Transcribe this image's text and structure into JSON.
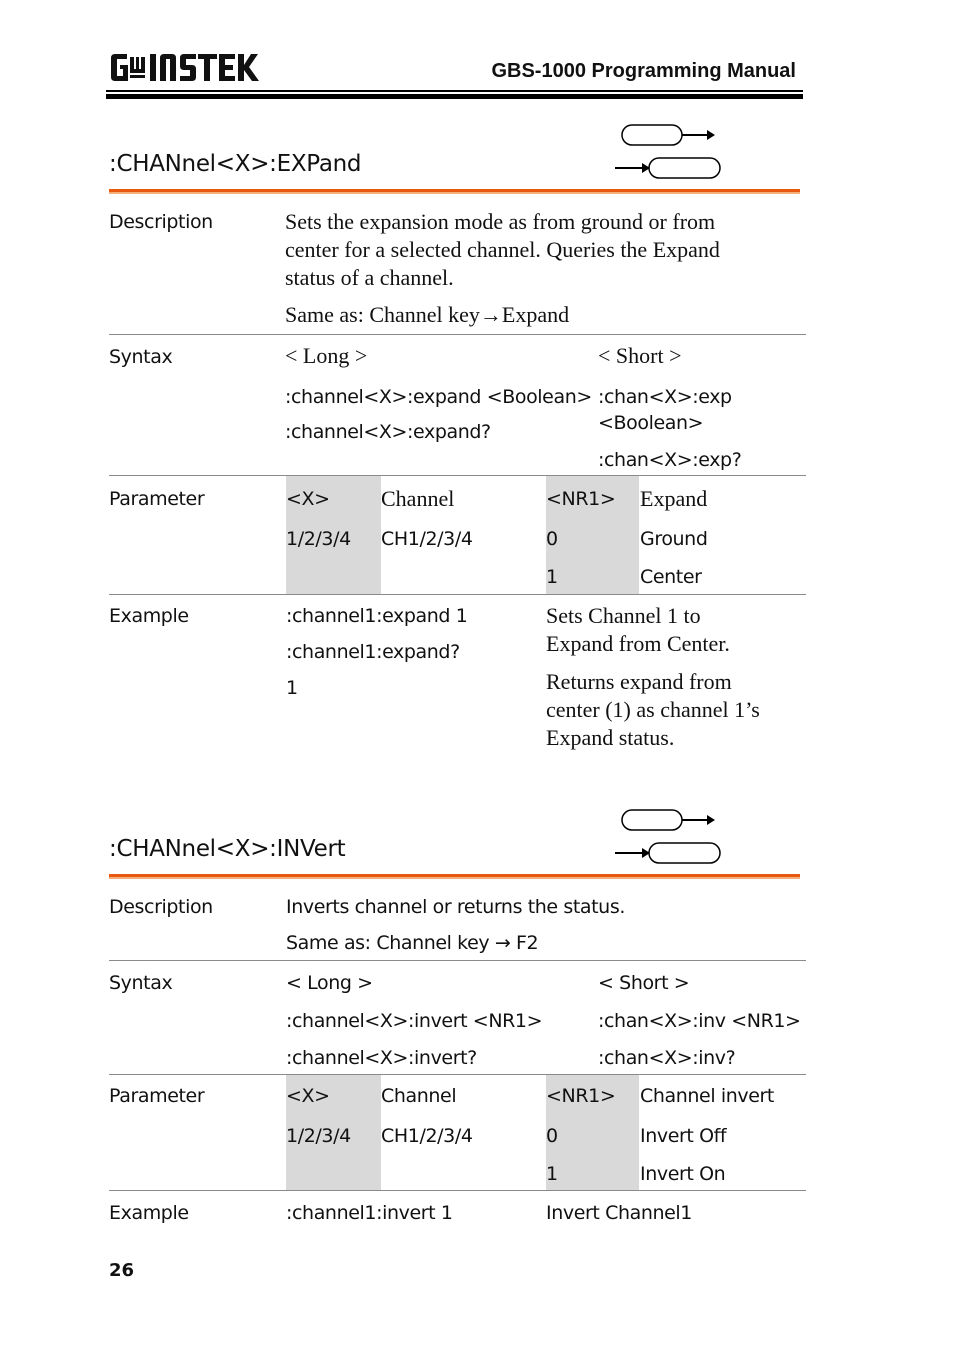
{
  "header": {
    "logo_text": "GW INSTEK",
    "manual_title": "GBS-1000 Programming Manual"
  },
  "icons": {
    "set_icon": "set-command-icon",
    "query_icon": "query-command-icon"
  },
  "accent_color": "#e8590f",
  "sections": [
    {
      "title": ":CHANnel<X>:EXPand",
      "description": {
        "label": "Description",
        "lines": [
          "Sets the expansion mode as from ground or from",
          "center for a selected channel. Queries the Expand",
          "status of a channel."
        ],
        "same_as": "Same as: Channel key→Expand"
      },
      "syntax": {
        "label": "Syntax",
        "long_header": "< Long >",
        "short_header": "< Short >",
        "long": [
          ":channel<X>:expand <Boolean>",
          ":channel<X>:expand?"
        ],
        "short": [
          ":chan<X>:exp",
          "<Boolean>",
          ":chan<X>:exp?"
        ]
      },
      "parameter": {
        "label": "Parameter",
        "col1_header": "<X>",
        "col1_value": "1/2/3/4",
        "col2_header": "Channel",
        "col2_value": "CH1/2/3/4",
        "col3_header": "<NR1>",
        "col3_values": [
          "0",
          "1"
        ],
        "col4_header": "Expand",
        "col4_values": [
          "Ground",
          "Center"
        ]
      },
      "example": {
        "label": "Example",
        "commands": [
          ":channel1:expand 1",
          ":channel1:expand?",
          "1"
        ],
        "notes": [
          [
            "Sets Channel 1 to",
            "Expand from Center."
          ],
          [
            "Returns expand from",
            "center (1) as channel 1’s",
            "Expand status."
          ]
        ]
      }
    },
    {
      "title": ":CHANnel<X>:INVert",
      "description": {
        "label": "Description",
        "lines": [
          "Inverts channel or returns the status."
        ],
        "same_as": "Same as: Channel key → F2"
      },
      "syntax": {
        "label": "Syntax",
        "long_header": "< Long >",
        "short_header": "< Short >",
        "long": [
          ":channel<X>:invert <NR1>",
          ":channel<X>:invert?"
        ],
        "short": [
          ":chan<X>:inv <NR1>",
          ":chan<X>:inv?"
        ]
      },
      "parameter": {
        "label": "Parameter",
        "col1_header": "<X>",
        "col1_value": "1/2/3/4",
        "col2_header": "Channel",
        "col2_value": "CH1/2/3/4",
        "col3_header": "<NR1>",
        "col3_values": [
          "0",
          "1"
        ],
        "col4_header": "Channel invert",
        "col4_values": [
          "Invert Off",
          "Invert On"
        ]
      },
      "example": {
        "label": "Example",
        "commands": [
          ":channel1:invert 1"
        ],
        "notes": [
          [
            "Invert Channel1"
          ]
        ]
      }
    }
  ],
  "footer": {
    "page_number": "26"
  }
}
